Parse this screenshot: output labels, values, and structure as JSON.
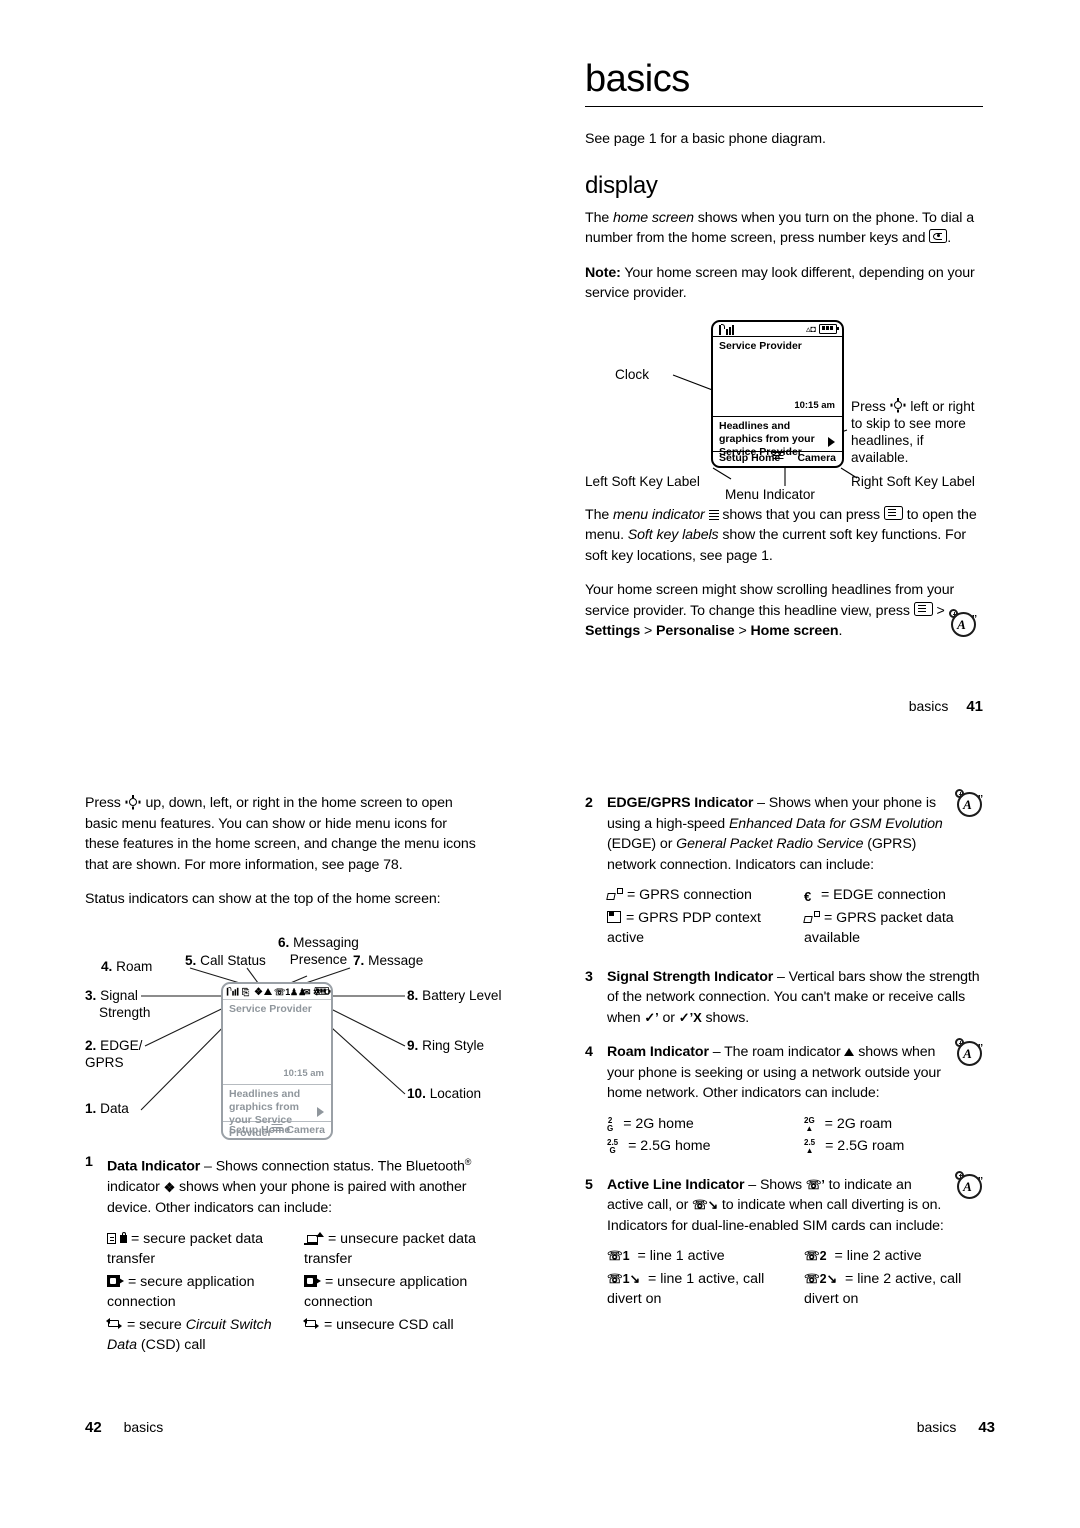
{
  "doc": {
    "chapter_title": "basics",
    "section_title": "display"
  },
  "page41": {
    "intro": "See page 1 for a basic phone diagram.",
    "para1_a": "The ",
    "para1_italic": "home screen",
    "para1_b": " shows when you turn on the phone. To dial a number from the home screen, press number keys and ",
    "para1_c": ".",
    "note_label": "Note:",
    "note_text": " Your home screen may look different, depending on your service provider.",
    "para2_a": "The ",
    "para2_italic1": "menu indicator",
    "para2_b": " shows that you can press ",
    "para2_c": " to open the menu. ",
    "para2_italic2": "Soft key labels",
    "para2_d": " show the current soft key functions. For soft key locations, see page 1.",
    "para3_a": "Your home screen might show scrolling headlines from your service provider. To change this headline view, press ",
    "para3_b": " > ",
    "para3_settings": "Settings",
    "para3_personalise": "Personalise",
    "para3_home_screen": "Home screen",
    "para3_end": ".",
    "footer_label": "basics",
    "footer_number": "41",
    "diagram": {
      "service_provider": "Service Provider",
      "clock_value": "10:15 am",
      "headlines_line1": "Headlines and graphics from your",
      "headlines_line2": "Service Provider",
      "soft_key_left": "Setup Home",
      "soft_key_right": "Camera",
      "label_clock": "Clock",
      "label_left_soft_key": "Left Soft Key Label",
      "label_right_soft_key": "Right Soft Key Label",
      "label_menu_indicator": "Menu Indicator",
      "label_press_nav_line1": "Press",
      "label_press_nav_line1b": "left or right",
      "label_press_nav_line2": "to skip to see more",
      "label_press_nav_line3": "headlines, if available."
    }
  },
  "page42": {
    "para1": "Press ·\u0001· up, down, left, or right in the home screen to open basic menu features. You can show or hide menu icons for these features in the home screen, and change the menu icons that are shown. For more information, see page 78.",
    "para1_a": "Press ",
    "para1_b": " up, down, left, or right in the home screen to open basic menu features. You can show or hide menu icons for these features in the home screen, and change the menu icons that are shown. For more information, see page 78.",
    "para2": "Status indicators can show at the top of the home screen:",
    "diagram": {
      "service_provider": "Service Provider",
      "clock_value": "10:15 am",
      "headlines_line1": "Headlines and graphics from your",
      "headlines_line2": "Service Provider",
      "soft_key_left": "Setup Home",
      "soft_key_right": "Camera",
      "callouts": [
        {
          "num": "1.",
          "label": "Data"
        },
        {
          "num": "2.",
          "label": "EDGE/",
          "label2": "GPRS"
        },
        {
          "num": "3.",
          "label": "Signal",
          "label2": "Strength"
        },
        {
          "num": "4.",
          "label": "Roam"
        },
        {
          "num": "5.",
          "label": "Call Status"
        },
        {
          "num": "6.",
          "label": "Messaging",
          "label2": "Presence"
        },
        {
          "num": "7.",
          "label": "Message"
        },
        {
          "num": "8.",
          "label": "Battery Level"
        },
        {
          "num": "9.",
          "label": "Ring Style"
        },
        {
          "num": "10.",
          "label": "Location"
        }
      ]
    },
    "item1": {
      "number": "1",
      "title": "Data Indicator",
      "dash": " – ",
      "text_a": "Shows connection status. The Bluetooth",
      "reg": "®",
      "text_b": " indicator ",
      "text_c": " shows when your phone is paired with another device. Other indicators can include:",
      "rows": [
        {
          "left_text": "= secure packet data transfer",
          "left_icon": "secure-packet-data-icon",
          "right_text": "= unsecure packet data transfer",
          "right_icon": "unsecure-packet-data-icon"
        },
        {
          "left_text": "= secure application connection",
          "left_icon": "secure-application-icon",
          "right_text": "= unsecure application connection",
          "right_icon": "unsecure-application-icon"
        },
        {
          "left_text_a": "= secure ",
          "left_italic": "Circuit Switch Data",
          "left_text_b": " (CSD) call",
          "left_icon": "secure-csd-icon",
          "right_text": "= unsecure CSD call",
          "right_icon": "unsecure-csd-icon"
        }
      ]
    },
    "footer_label": "basics",
    "footer_number": "42"
  },
  "page43": {
    "item2": {
      "number": "2",
      "title": "EDGE/GPRS Indicator",
      "dash": " – ",
      "text_a": "Shows when your phone is using a high-speed ",
      "italic1": "Enhanced Data for GSM Evolution",
      "text_b": " (EDGE) or ",
      "italic2": "General Packet Radio Service",
      "text_c": " (GPRS) network connection. Indicators can include:",
      "rows": [
        {
          "left_text": "= GPRS connection",
          "left_icon": "gprs-connection-icon",
          "right_text": "= EDGE connection",
          "right_icon": "edge-connection-icon"
        },
        {
          "left_text": "= GPRS PDP context active",
          "left_icon": "gprs-pdp-context-icon",
          "right_text": "= GPRS packet data available",
          "right_icon": "gprs-packet-data-icon"
        }
      ]
    },
    "item3": {
      "number": "3",
      "title": "Signal Strength Indicator",
      "dash": " – ",
      "text_a": "Vertical bars show the strength of the network connection. You can't make or receive calls when ",
      "text_b": " or ",
      "text_c": " shows."
    },
    "item4": {
      "number": "4",
      "title": "Roam Indicator",
      "dash": " – ",
      "text_a": "The roam indicator ",
      "text_b": " shows when your phone is seeking or using a network outside your home network. Other indicators can include:",
      "rows": [
        {
          "left_text": "= 2G home",
          "left_icon": "2g-home-icon",
          "right_text": "= 2G roam",
          "right_icon": "2g-roam-icon"
        },
        {
          "left_text": "= 2.5G home",
          "left_icon": "2.5g-home-icon",
          "right_text": "= 2.5G roam",
          "right_icon": "2.5g-roam-icon"
        }
      ]
    },
    "item5": {
      "number": "5",
      "title": "Active Line Indicator",
      "dash": " – ",
      "text_a": "Shows ",
      "text_b": " to indicate an active call, or ",
      "text_c": " to indicate when call diverting is on. Indicators for dual-line-enabled SIM cards can include:",
      "rows": [
        {
          "left_text": "= line 1 active",
          "left_icon": "line-1-active-icon",
          "right_text": "= line 2 active",
          "right_icon": "line-2-active-icon"
        },
        {
          "left_text": "= line 1 active, call divert on",
          "left_icon": "line-1-divert-icon",
          "right_text": "= line 2 active, call divert on",
          "right_icon": "line-2-divert-icon"
        }
      ]
    },
    "footer_label": "basics",
    "footer_number": "43"
  }
}
